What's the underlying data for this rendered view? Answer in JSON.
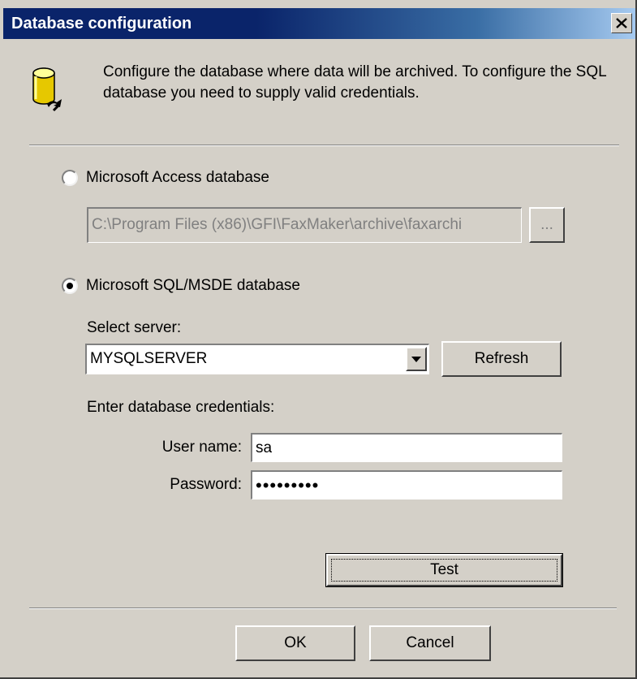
{
  "window": {
    "title": "Database configuration",
    "close_glyph": "✕"
  },
  "description": "Configure the database where data will be archived. To configure the SQL database you need to supply valid credentials.",
  "access": {
    "label": "Microsoft Access database",
    "selected": false,
    "path_value": "C:\\Program Files (x86)\\GFI\\FaxMaker\\archive\\faxarchi",
    "browse_label": "..."
  },
  "sql": {
    "label": "Microsoft SQL/MSDE database",
    "selected": true,
    "select_server_label": "Select server:",
    "server_value": "MYSQLSERVER",
    "refresh_label": "Refresh",
    "credentials_label": "Enter database credentials:",
    "username_label": "User name:",
    "username_value": "sa",
    "password_label": "Password:",
    "password_value": "•••••••••",
    "test_label": "Test"
  },
  "footer": {
    "ok_label": "OK",
    "cancel_label": "Cancel"
  },
  "icons": {
    "app_icon": "database-icon",
    "close": "close-icon",
    "dropdown": "dropdown-arrow-icon"
  },
  "colors": {
    "face": "#d4d0c8",
    "titlebar_start": "#0a246a",
    "titlebar_end": "#a6caf0"
  }
}
